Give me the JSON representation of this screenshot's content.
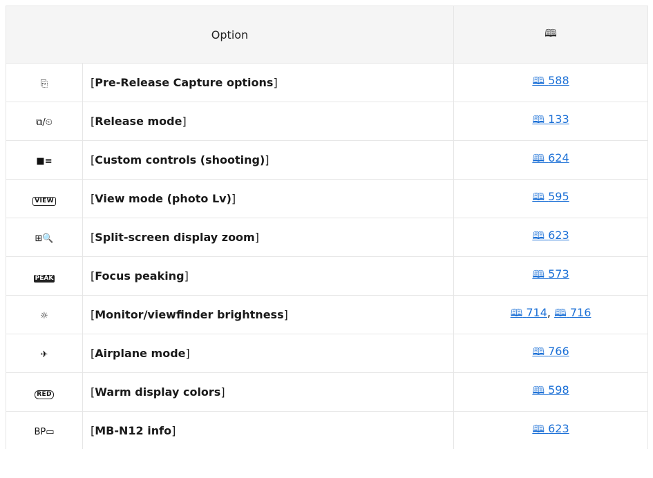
{
  "header": {
    "option_label": "Option",
    "reference_glyph": "🕮"
  },
  "rows": [
    {
      "icon": "pre-release-capture-icon",
      "icon_text": "⎘",
      "option": "Pre-Release Capture options",
      "refs": [
        "588"
      ]
    },
    {
      "icon": "release-mode-icon",
      "icon_text": "⧉/⏲",
      "option": "Release mode",
      "refs": [
        "133"
      ]
    },
    {
      "icon": "custom-controls-icon",
      "icon_text": "■≡",
      "option": "Custom controls (shooting)",
      "refs": [
        "624"
      ]
    },
    {
      "icon": "view-icon",
      "icon_text": "VIEW",
      "option": "View mode (photo Lv)",
      "refs": [
        "595"
      ]
    },
    {
      "icon": "split-screen-zoom-icon",
      "icon_text": "⊞🔍",
      "option": "Split-screen display zoom",
      "refs": [
        "623"
      ]
    },
    {
      "icon": "peak-icon",
      "icon_text": "PEAK",
      "option": "Focus peaking",
      "refs": [
        "573"
      ]
    },
    {
      "icon": "brightness-icon",
      "icon_text": "☼",
      "option": "Monitor/viewfinder brightness",
      "refs": [
        "714",
        "716"
      ]
    },
    {
      "icon": "airplane-icon",
      "icon_text": "✈",
      "option": "Airplane mode",
      "refs": [
        "766"
      ]
    },
    {
      "icon": "red-icon",
      "icon_text": "RED",
      "option": "Warm display colors",
      "refs": [
        "598"
      ]
    },
    {
      "icon": "battery-pack-icon",
      "icon_text": "BP▭",
      "option": "MB-N12 info",
      "refs": [
        "623"
      ]
    }
  ]
}
